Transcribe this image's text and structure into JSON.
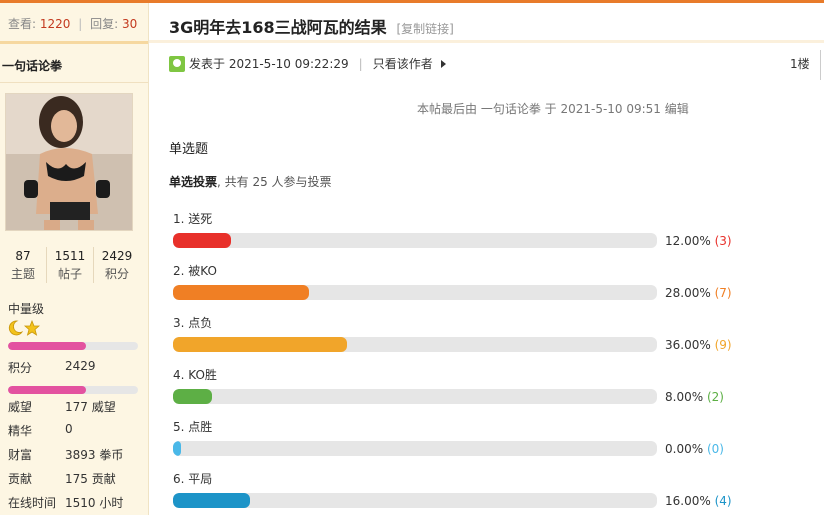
{
  "thread": {
    "views_label": "查看:",
    "views": "1220",
    "replies_label": "回复:",
    "replies": "30",
    "title": "3G明年去168三战阿瓦的结果",
    "copy_link": "[复制链接]"
  },
  "author": {
    "name": "一句话论拳",
    "counts": [
      {
        "value": "87",
        "label": "主题"
      },
      {
        "value": "1511",
        "label": "帖子"
      },
      {
        "value": "2429",
        "label": "积分"
      }
    ],
    "level": "中量级",
    "level_progress": 0.6,
    "credit_progress": 0.6,
    "stats": [
      {
        "key": "积分",
        "value": "2429"
      },
      {
        "key": "威望",
        "value": "177 威望"
      },
      {
        "key": "精华",
        "value": "0"
      },
      {
        "key": "财富",
        "value": "3893 拳币"
      },
      {
        "key": "贡献",
        "value": "175 贡献"
      },
      {
        "key": "在线时间",
        "value": "1510 小时"
      }
    ]
  },
  "post": {
    "posted_at": "发表于 2021-5-10 09:22:29",
    "only_author": "只看该作者",
    "floor": "1楼",
    "last_edit": "本帖最后由 一句话论拳 于 2021-5-10 09:51 编辑",
    "question_type": "单选题"
  },
  "poll": {
    "type_label": "单选投票",
    "summary": ", 共有 25 人参与投票",
    "options": [
      {
        "label": "1.  送死",
        "percent": "12.00%",
        "count": "(3)",
        "ratio": 0.12,
        "color": "#e8302a"
      },
      {
        "label": "2.  被KO",
        "percent": "28.00%",
        "count": "(7)",
        "ratio": 0.28,
        "color": "#f07f24"
      },
      {
        "label": "3.  点负",
        "percent": "36.00%",
        "count": "(9)",
        "ratio": 0.36,
        "color": "#f1a52a"
      },
      {
        "label": "4.  KO胜",
        "percent": "8.00%",
        "count": "(2)",
        "ratio": 0.08,
        "color": "#5daf45"
      },
      {
        "label": "5.  点胜",
        "percent": "0.00%",
        "count": "(0)",
        "ratio": 0.0,
        "color": "#4ab8e8"
      },
      {
        "label": "6.  平局",
        "percent": "16.00%",
        "count": "(4)",
        "ratio": 0.16,
        "color": "#1d94c8"
      }
    ]
  }
}
